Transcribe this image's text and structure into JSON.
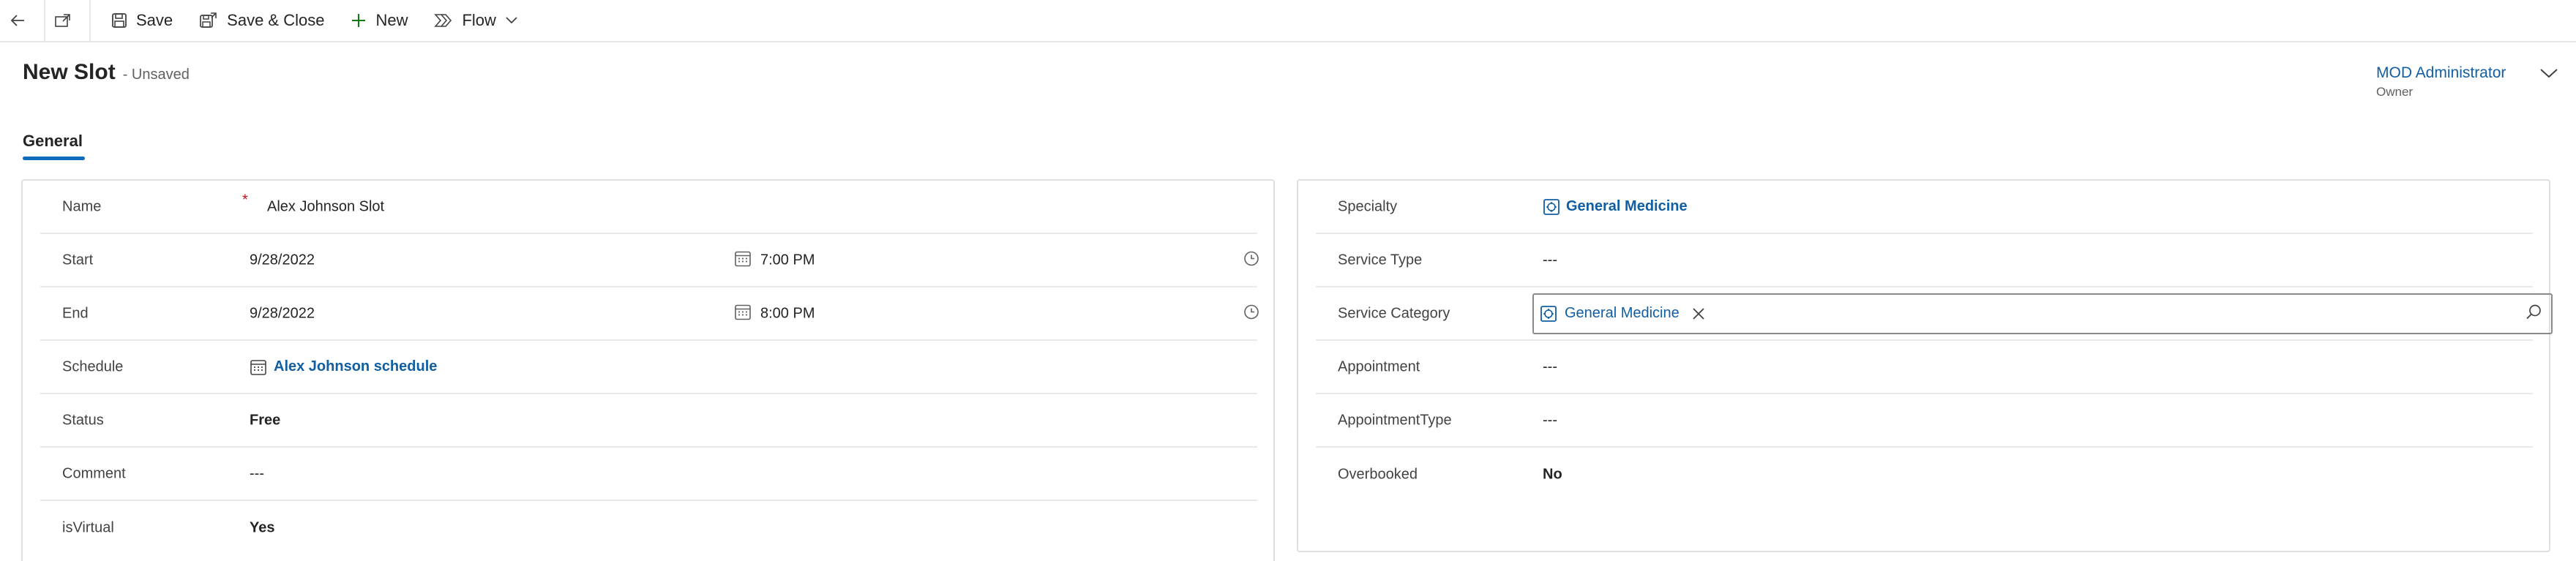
{
  "toolbar": {
    "save_label": "Save",
    "save_close_label": "Save & Close",
    "new_label": "New",
    "flow_label": "Flow"
  },
  "header": {
    "title": "New Slot",
    "status": "- Unsaved",
    "owner_name": "MOD Administrator",
    "owner_label": "Owner"
  },
  "tabs": [
    {
      "label": "General"
    }
  ],
  "left_section": {
    "name": {
      "label": "Name",
      "required": "*",
      "value": "Alex Johnson Slot"
    },
    "start": {
      "label": "Start",
      "date": "9/28/2022",
      "time": "7:00 PM"
    },
    "end": {
      "label": "End",
      "date": "9/28/2022",
      "time": "8:00 PM"
    },
    "schedule": {
      "label": "Schedule",
      "value": "Alex Johnson schedule"
    },
    "status": {
      "label": "Status",
      "value": "Free"
    },
    "comment": {
      "label": "Comment",
      "value": "---"
    },
    "is_virtual": {
      "label": "isVirtual",
      "value": "Yes"
    }
  },
  "right_section": {
    "specialty": {
      "label": "Specialty",
      "value": "General Medicine"
    },
    "service_type": {
      "label": "Service Type",
      "value": "---"
    },
    "service_category": {
      "label": "Service Category",
      "value": "General Medicine"
    },
    "appointment": {
      "label": "Appointment",
      "value": "---"
    },
    "appointment_type": {
      "label": "AppointmentType",
      "value": "---"
    },
    "overbooked": {
      "label": "Overbooked",
      "value": "No"
    }
  },
  "colors": {
    "link": "#115ea3",
    "accent": "#0f6cbd",
    "required": "#c50f1f"
  }
}
